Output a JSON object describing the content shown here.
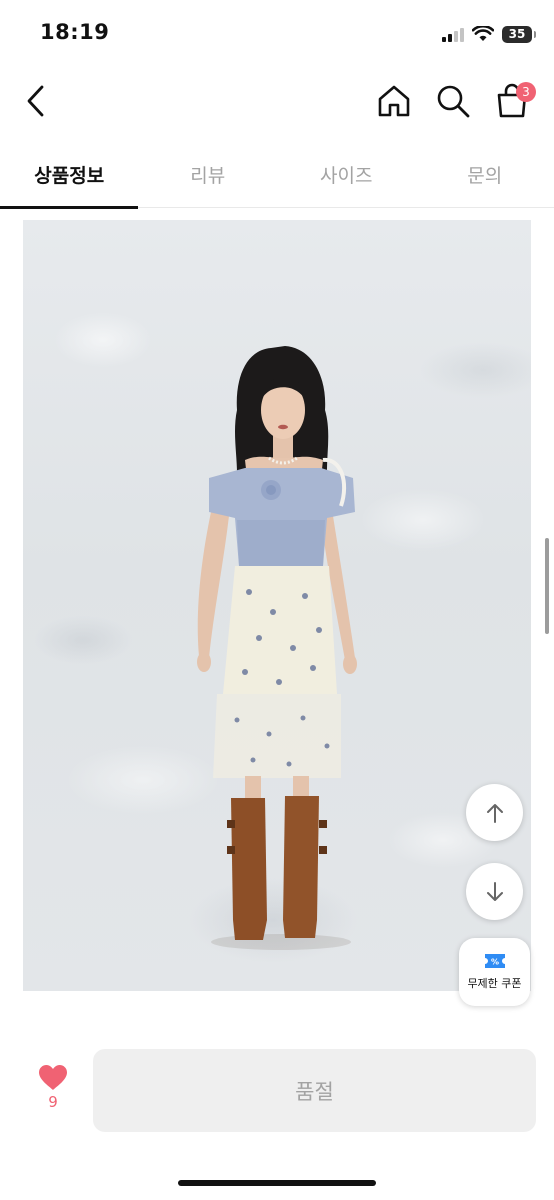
{
  "status_bar": {
    "time": "18:19",
    "battery_level": "35"
  },
  "header": {
    "back_icon": "chevron-left-icon",
    "home_icon": "home-icon",
    "search_icon": "search-icon",
    "cart_icon": "shopping-bag-icon",
    "cart_count": "3"
  },
  "tabs": [
    {
      "label": "상품정보",
      "active": true
    },
    {
      "label": "리뷰",
      "active": false
    },
    {
      "label": "사이즈",
      "active": false
    },
    {
      "label": "문의",
      "active": false
    }
  ],
  "floating": {
    "scroll_up_icon": "arrow-up-icon",
    "scroll_down_icon": "arrow-down-icon",
    "coupon_icon": "coupon-icon",
    "coupon_label": "무제한 쿠폰"
  },
  "bottom_bar": {
    "like_icon": "heart-icon",
    "like_count": "9",
    "purchase_label": "품절"
  },
  "colors": {
    "accent": "#f06273",
    "coupon_blue": "#2f8cf4",
    "soldout_bg": "#efefef",
    "soldout_text": "#a2a2a2"
  }
}
